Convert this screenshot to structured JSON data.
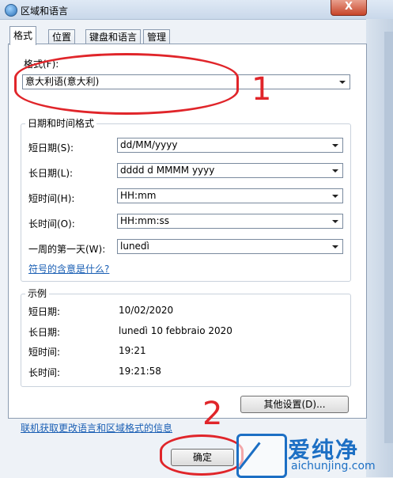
{
  "window": {
    "title": "区域和语言",
    "close_label": "X"
  },
  "tabs": [
    "格式",
    "位置",
    "键盘和语言",
    "管理"
  ],
  "format": {
    "label": "格式(F):",
    "selected": "意大利语(意大利)"
  },
  "datetime_group": {
    "legend": "日期和时间格式",
    "rows": [
      {
        "label": "短日期(S):",
        "value": "dd/MM/yyyy"
      },
      {
        "label": "长日期(L):",
        "value": "dddd d MMMM yyyy"
      },
      {
        "label": "短时间(H):",
        "value": "HH:mm"
      },
      {
        "label": "长时间(O):",
        "value": "HH:mm:ss"
      },
      {
        "label": "一周的第一天(W):",
        "value": "lunedì"
      }
    ],
    "symbols_link": "符号的含意是什么?"
  },
  "example_group": {
    "legend": "示例",
    "rows": [
      {
        "label": "短日期:",
        "value": "10/02/2020"
      },
      {
        "label": "长日期:",
        "value": "lunedì 10 febbraio 2020"
      },
      {
        "label": "短时间:",
        "value": "19:21"
      },
      {
        "label": "长时间:",
        "value": "19:21:58"
      }
    ]
  },
  "other_settings_button": "其他设置(D)...",
  "online_link": "联机获取更改语言和区域格式的信息",
  "ok_button": "确定",
  "annotations": {
    "first": "1",
    "second": "2"
  },
  "watermark": {
    "title": "爱纯净",
    "url": "aichunjing.com"
  },
  "colors": {
    "annotation": "#e0252a",
    "link": "#1a5fb4",
    "watermark": "#1c6fc4"
  }
}
